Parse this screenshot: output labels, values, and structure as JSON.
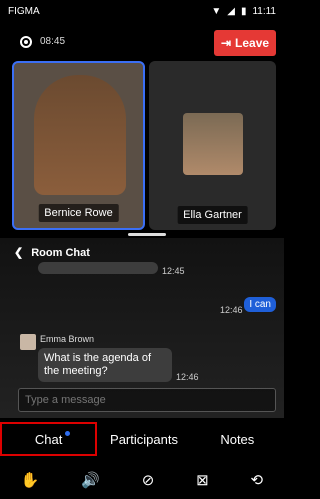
{
  "status": {
    "carrier": "FIGMA",
    "time": "11:11"
  },
  "header": {
    "recording_time": "08:45",
    "leave_label": "Leave"
  },
  "participants": [
    {
      "name": "Bernice Rowe"
    },
    {
      "name": "Ella Gartner"
    }
  ],
  "chat": {
    "title": "Room Chat",
    "prev_time": "12:45",
    "own_message_time": "12:46",
    "own_message": "I can",
    "sender_name": "Emma Brown",
    "incoming_message": "What is the agenda of the meeting?",
    "incoming_time": "12:46",
    "input_placeholder": "Type a message"
  },
  "tabs": [
    "Chat",
    "Participants",
    "Notes"
  ],
  "colors": {
    "leave": "#e53935",
    "accent": "#2f6ef0",
    "own_bubble": "#1f5fd8"
  },
  "toolbar_icons": [
    "hand-icon",
    "speaker-icon",
    "mic-off-icon",
    "camera-off-icon",
    "switch-camera-icon"
  ]
}
